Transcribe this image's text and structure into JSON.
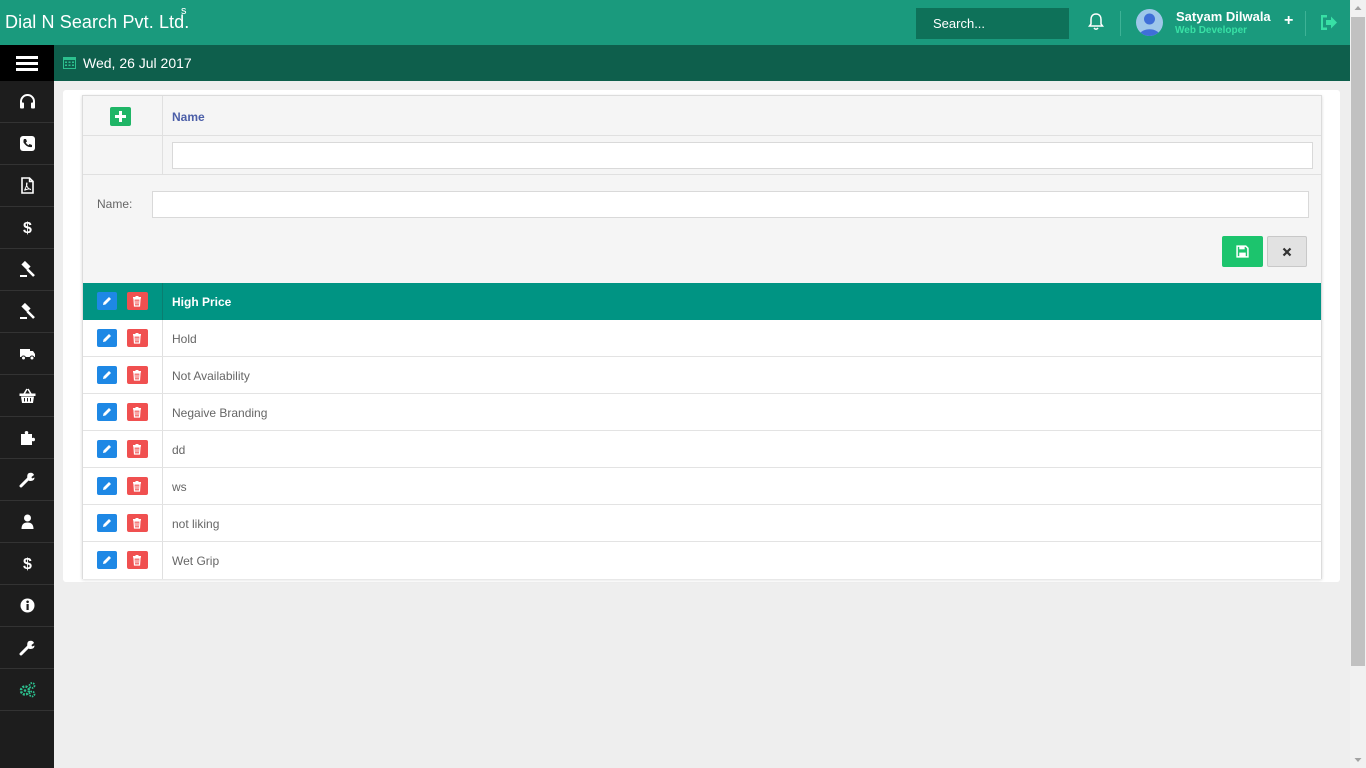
{
  "header": {
    "brand": "Dial N Search Pvt. Ltd.",
    "brand_sup": "s",
    "search_placeholder": "Search...",
    "user_name": "Satyam Dilwala",
    "user_role": "Web Developer",
    "user_action": "+",
    "colors": {
      "primary": "#1a9a7d",
      "dark": "#0e5f4c",
      "accent": "#38e0a5"
    }
  },
  "subbar": {
    "date": "Wed, 26 Jul 2017"
  },
  "sidebar": {
    "items": [
      {
        "icon": "headphones-icon"
      },
      {
        "icon": "phone-icon"
      },
      {
        "icon": "pdf-file-icon"
      },
      {
        "icon": "dollar-icon"
      },
      {
        "icon": "gavel-icon"
      },
      {
        "icon": "gavel-icon"
      },
      {
        "icon": "truck-icon"
      },
      {
        "icon": "basket-icon"
      },
      {
        "icon": "puzzle-icon"
      },
      {
        "icon": "wrench-icon"
      },
      {
        "icon": "user-icon"
      },
      {
        "icon": "dollar-icon"
      },
      {
        "icon": "info-icon"
      },
      {
        "icon": "wrench-icon"
      },
      {
        "icon": "cogs-icon"
      }
    ]
  },
  "grid": {
    "column_header": "Name",
    "filter_value": "",
    "form": {
      "label": "Name:",
      "value": ""
    },
    "rows": [
      {
        "name": "High Price",
        "selected": true
      },
      {
        "name": "Hold"
      },
      {
        "name": "Not Availability"
      },
      {
        "name": "Negaive Branding"
      },
      {
        "name": "dd"
      },
      {
        "name": "ws"
      },
      {
        "name": "not liking"
      },
      {
        "name": "Wet Grip"
      }
    ]
  }
}
